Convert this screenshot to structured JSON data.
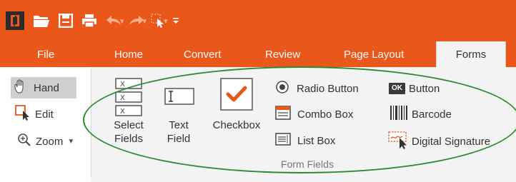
{
  "tabs": [
    {
      "label": "File"
    },
    {
      "label": "Home"
    },
    {
      "label": "Convert"
    },
    {
      "label": "Review"
    },
    {
      "label": "Page Layout"
    },
    {
      "label": "Forms",
      "active": true
    }
  ],
  "left_tools": {
    "hand": "Hand",
    "edit": "Edit",
    "zoom": "Zoom"
  },
  "form_fields": {
    "select_fields": "Select\nFields",
    "text_field": "Text\nField",
    "checkbox": "Checkbox",
    "radio_button": "Radio Button",
    "combo_box": "Combo Box",
    "list_box": "List Box",
    "button": "Button",
    "button_badge": "OK",
    "barcode": "Barcode",
    "digital_signature": "Digital Signature",
    "group_label": "Form Fields"
  },
  "colors": {
    "accent": "#e9571b",
    "highlight_ellipse": "#2f8a33",
    "checkbox_mark": "#e9571b"
  }
}
